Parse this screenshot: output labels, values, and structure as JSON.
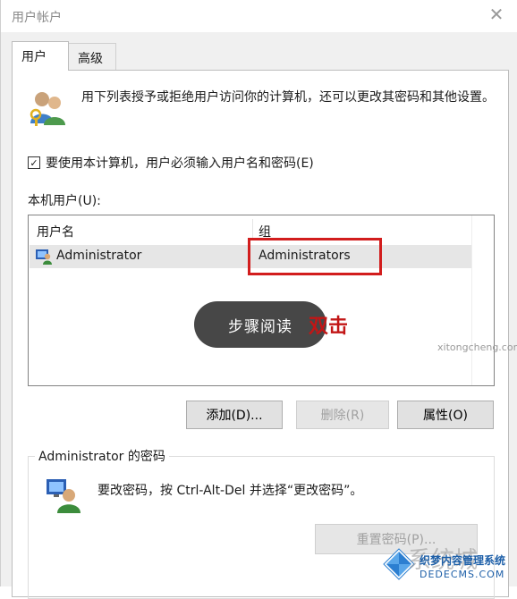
{
  "window": {
    "title": "用户帐户",
    "close_glyph": "✕"
  },
  "tabs": [
    {
      "label": "用户",
      "active": true
    },
    {
      "label": "高级",
      "active": false
    }
  ],
  "description": "用下列表授予或拒绝用户访问你的计算机，还可以更改其密码和其他设置。",
  "require_login": {
    "label": "要使用本计算机，用户必须输入用户名和密码(E)",
    "checked": true,
    "check_glyph": "✓"
  },
  "local_users": {
    "label": "本机用户(U):",
    "columns": [
      "用户名",
      "组"
    ],
    "rows": [
      {
        "name": "Administrator",
        "group": "Administrators",
        "icon": "user-account-icon"
      }
    ]
  },
  "buttons": {
    "add": "添加(D)...",
    "remove": "删除(R)",
    "properties": "属性(O)"
  },
  "password_section": {
    "title": "Administrator 的密码",
    "text": "要改密码，按 Ctrl-Alt-Del 并选择“更改密码”。",
    "reset_button": "重置密码(P)..."
  },
  "overlay": {
    "pill_text": "步骤阅读",
    "red_text": "双击"
  },
  "watermark": {
    "site_text": "系统城",
    "brand": "织梦内容管理系统",
    "url": "DEDECMS.COM",
    "sub_url": "xitongcheng.com"
  },
  "colors": {
    "highlight_box": "#d21d1d",
    "selected_row": "#e6e6e6",
    "panel": "#ffffff",
    "window_bg": "#f0f0f0"
  }
}
